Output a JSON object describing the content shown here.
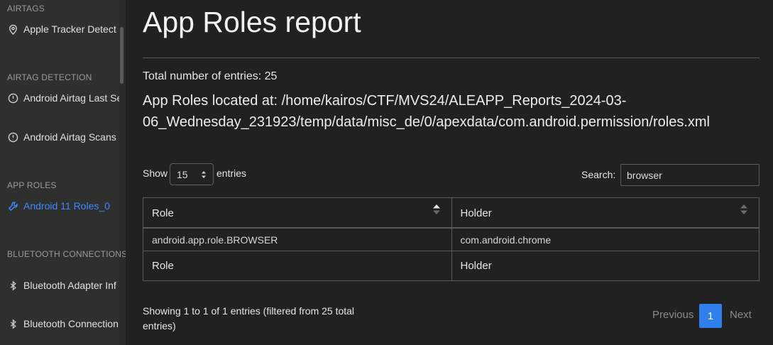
{
  "sidebar": {
    "sections": [
      {
        "heading": "AIRTAGS",
        "items": [
          {
            "label": "Apple Tracker Detect",
            "icon": "map-pin-icon",
            "active": false
          }
        ]
      },
      {
        "heading": "AIRTAG DETECTION",
        "items": [
          {
            "label": "Android Airtag Last Se",
            "icon": "alert-circle-icon",
            "active": false
          },
          {
            "label": "Android Airtag Scans",
            "icon": "alert-circle-icon",
            "active": false
          }
        ]
      },
      {
        "heading": "APP ROLES",
        "items": [
          {
            "label": "Android 11 Roles_0",
            "icon": "wrench-icon",
            "active": true
          }
        ]
      },
      {
        "heading": "BLUETOOTH CONNECTIONS",
        "items": [
          {
            "label": "Bluetooth Adapter Inf",
            "icon": "bluetooth-icon",
            "active": false
          },
          {
            "label": "Bluetooth Connection",
            "icon": "bluetooth-icon",
            "active": false
          }
        ]
      }
    ]
  },
  "main": {
    "title": "App Roles report",
    "total_entries": "Total number of entries: 25",
    "location": "App Roles located at: /home/kairos/CTF/MVS24/ALEAPP_Reports_2024-03-06_Wednesday_231923/temp/data/misc_de/0/apexdata/com.android.permission/roles.xml",
    "location_line1": "App Roles located at: /home/kairos/CTF/MVS24/ALEAPP_Reports_2024-03-",
    "location_line2": "06_Wednesday_231923/temp/data/misc_de/0/apexdata/com.android.permission/roles.xml"
  },
  "table_controls": {
    "show_label": "Show",
    "page_length": "15",
    "entries_label": "entries",
    "search_label": "Search:",
    "search_value": "browser"
  },
  "table": {
    "columns": [
      "Role",
      "Holder"
    ],
    "rows": [
      [
        "android.app.role.BROWSER",
        "com.android.chrome"
      ]
    ],
    "footer": [
      "Role",
      "Holder"
    ]
  },
  "pagination": {
    "info": "Showing 1 to 1 of 1 entries (filtered from 25 total entries)",
    "previous": "Previous",
    "current_page": "1",
    "next": "Next"
  },
  "colors": {
    "accent": "#2f80ed",
    "active_link": "#3d8bfd",
    "background": "#212121",
    "sidebar": "#2f2f2f"
  }
}
